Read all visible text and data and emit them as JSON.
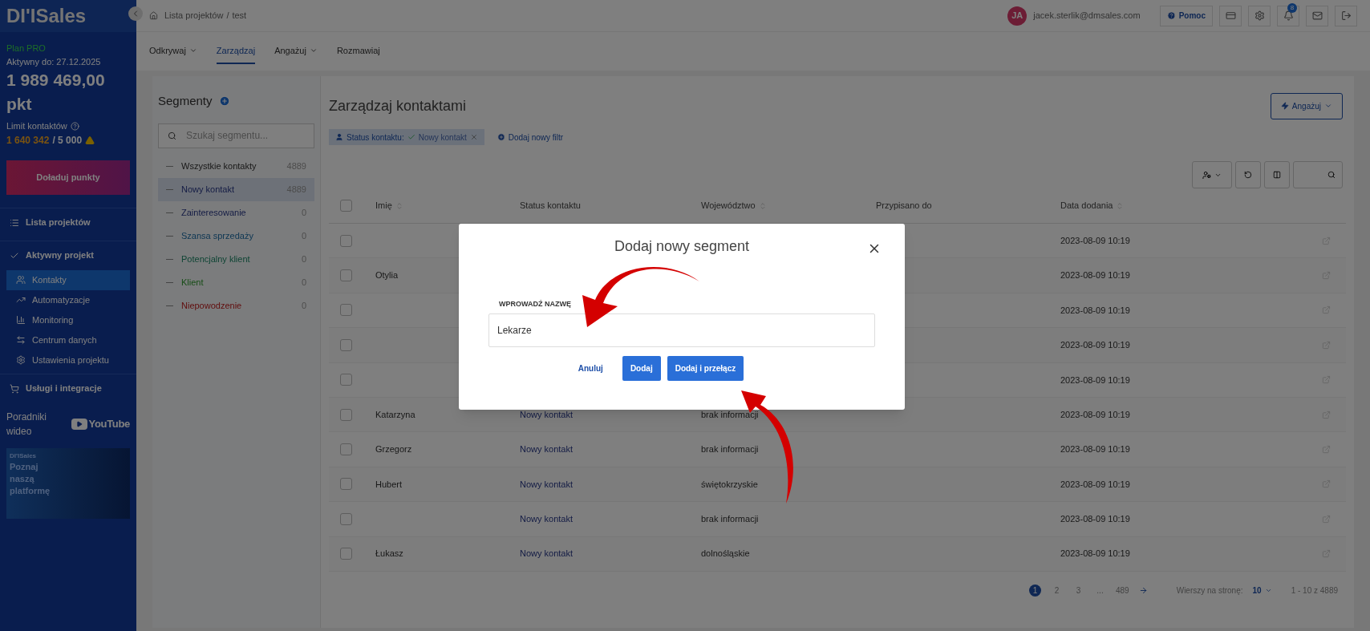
{
  "sidebar": {
    "logo": "DI'ISales",
    "plan": "Plan PRO",
    "active_until": "Aktywny do: 27.12.2025",
    "points": "1 989 469,00 pkt",
    "contact_limit_label": "Limit kontaktów",
    "contact_limit_used": "1 640 342",
    "contact_limit_total": "/ 5 000",
    "topup_button": "Doładuj punkty",
    "items": [
      {
        "kind": "section",
        "label": "Lista projektów",
        "selected": false
      },
      {
        "kind": "section",
        "label": "Aktywny projekt",
        "selected": false
      },
      {
        "kind": "sub",
        "label": "Kontakty",
        "selected": true
      },
      {
        "kind": "sub",
        "label": "Automatyzacje",
        "selected": false
      },
      {
        "kind": "sub",
        "label": "Monitoring",
        "selected": false
      },
      {
        "kind": "sub",
        "label": "Centrum danych",
        "selected": false
      },
      {
        "kind": "sub",
        "label": "Ustawienia projektu",
        "selected": false
      },
      {
        "kind": "section",
        "label": "Usługi i integracje",
        "selected": false
      }
    ],
    "video_label": "Poradniki wideo",
    "youtube_label": "YouTube",
    "promo": {
      "brand": "DI'ISales",
      "text": "Poznaj naszą platformę"
    }
  },
  "topbar": {
    "breadcrumb": [
      "Lista projektów",
      "test"
    ],
    "breadcrumb_separator": "/",
    "avatar": "JA",
    "email": "jacek.sterlik@dmsales.com",
    "help": "Pomoc",
    "notifications": "8"
  },
  "nav_tabs": [
    {
      "label": "Odkrywaj",
      "has_menu": true,
      "selected": false
    },
    {
      "label": "Zarządzaj",
      "has_menu": false,
      "selected": true
    },
    {
      "label": "Angażuj",
      "has_menu": true,
      "selected": false
    },
    {
      "label": "Rozmawiaj",
      "has_menu": false,
      "selected": false
    }
  ],
  "segments": {
    "title": "Segmenty",
    "search_placeholder": "Szukaj segmentu...",
    "items": [
      {
        "label": "Wszystkie kontakty",
        "count": "4889",
        "selected": false
      },
      {
        "label": "Nowy kontakt",
        "count": "4889",
        "selected": true
      },
      {
        "label": "Zainteresowanie",
        "count": "0",
        "selected": false
      },
      {
        "label": "Szansa sprzedaży",
        "count": "0",
        "selected": false
      },
      {
        "label": "Potencjalny klient",
        "count": "0",
        "selected": false
      },
      {
        "label": "Klient",
        "count": "0",
        "selected": false
      },
      {
        "label": "Niepowodzenie",
        "count": "0",
        "selected": false
      }
    ]
  },
  "main": {
    "title": "Zarządzaj kontaktami",
    "engage_button": "Angażuj",
    "filter": {
      "label": "Status kontaktu:",
      "value": "Nowy kontakt"
    },
    "add_filter": "Dodaj nowy filtr",
    "table": {
      "columns": [
        "Imię",
        "Status kontaktu",
        "Województwo",
        "Przypisano do",
        "Data dodania"
      ],
      "header_checked": false,
      "rows": [
        {
          "date": "2023-08-09 10:19",
          "checked": false
        },
        {
          "name": "Otylia",
          "date": "2023-08-09 10:19",
          "checked": false
        },
        {
          "date": "2023-08-09 10:19",
          "checked": false
        },
        {
          "date": "2023-08-09 10:19",
          "checked": false
        },
        {
          "date": "2023-08-09 10:19",
          "checked": false
        },
        {
          "name": "Katarzyna",
          "status": "Nowy kontakt",
          "province": "brak informacji",
          "date": "2023-08-09 10:19",
          "checked": false
        },
        {
          "name": "Grzegorz",
          "status": "Nowy kontakt",
          "province": "brak informacji",
          "date": "2023-08-09 10:19",
          "checked": false
        },
        {
          "name": "Hubert",
          "status": "Nowy kontakt",
          "province": "świętokrzyskie",
          "date": "2023-08-09 10:19",
          "checked": false
        },
        {
          "status": "Nowy kontakt",
          "province": "brak informacji",
          "date": "2023-08-09 10:19",
          "checked": false
        },
        {
          "name": "Łukasz",
          "status": "Nowy kontakt",
          "province": "dolnośląskie",
          "date": "2023-08-09 10:19",
          "checked": false
        }
      ]
    },
    "pagination": {
      "pages": [
        {
          "label": "1",
          "selected": true
        },
        {
          "label": "2",
          "selected": false
        },
        {
          "label": "3",
          "selected": false
        },
        {
          "label": "...",
          "selected": false
        },
        {
          "label": "489",
          "selected": false
        }
      ],
      "rows_per_page_label": "Wierszy na stronę:",
      "rows_per_page": "10",
      "range": "1 - 10 z 4889"
    }
  },
  "modal": {
    "title": "Dodaj nowy segment",
    "field_label": "WPROWADŹ NAZWĘ",
    "field_value": "Lekarze",
    "buttons": [
      {
        "kind": "link",
        "label": "Anuluj"
      },
      {
        "kind": "primary",
        "label": "Dodaj"
      },
      {
        "kind": "primary",
        "label": "Dodaj i przełącz"
      }
    ]
  }
}
